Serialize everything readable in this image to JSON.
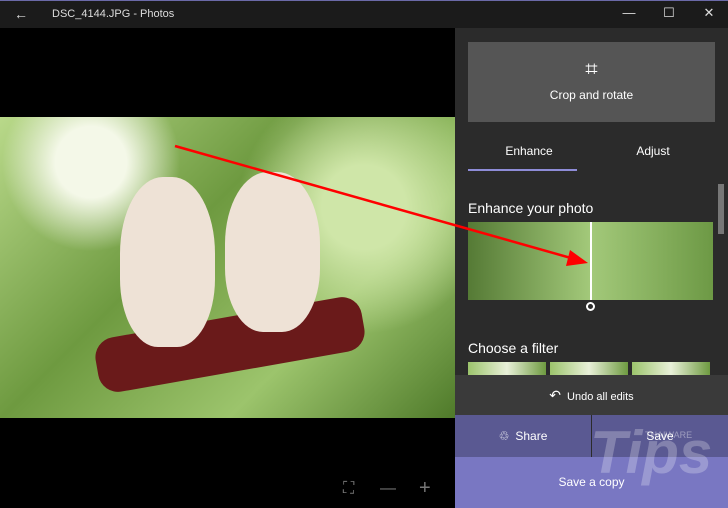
{
  "window": {
    "title": "DSC_4144.JPG - Photos",
    "back_icon": "←",
    "minimize": "—",
    "maximize": "☐",
    "close": "✕"
  },
  "viewer": {
    "toolbar": {
      "fit_icon": "⛶",
      "zoom_out": "—",
      "zoom_in": "+"
    }
  },
  "panel": {
    "crop_label": "Crop and rotate",
    "crop_icon": "⌗",
    "tabs": [
      {
        "label": "Enhance",
        "active": true
      },
      {
        "label": "Adjust",
        "active": false
      }
    ],
    "enhance_heading": "Enhance your photo",
    "filter_heading": "Choose a filter",
    "undo_label": "Undo all edits",
    "undo_icon": "↶",
    "share_label": "Share",
    "share_icon": "♲",
    "save_label": "Save",
    "save_copy_label": "Save a copy"
  },
  "annotation": {
    "color": "#ff0000"
  },
  "watermark": {
    "text": "Tips",
    "brand": "THAIWARE"
  },
  "colors": {
    "accent": "#7977c2",
    "tab_underline": "#8e8cd8"
  }
}
